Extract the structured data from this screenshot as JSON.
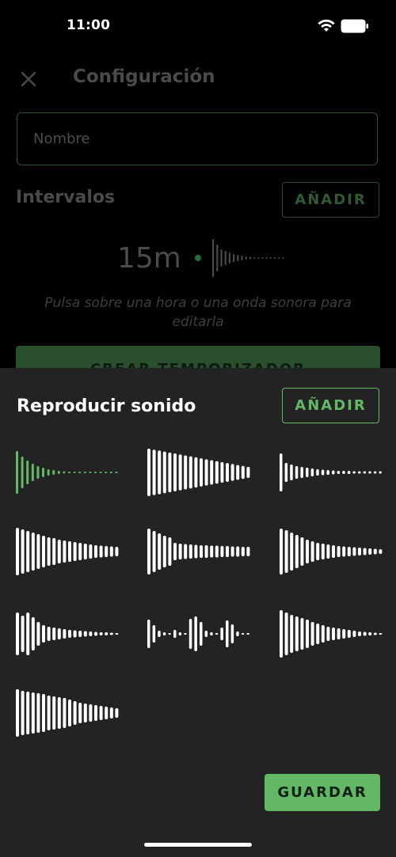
{
  "status_bar": {
    "time": "11:00",
    "icons": [
      "wifi-icon",
      "battery-icon"
    ]
  },
  "header": {
    "title": "Configuración",
    "close_icon": "close-icon"
  },
  "name_field": {
    "placeholder": "Nombre",
    "value": ""
  },
  "intervals": {
    "title": "Intervalos",
    "add_label": "AÑADIR",
    "items": [
      {
        "time": "15m"
      }
    ],
    "hint": "Pulsa sobre una hora o una onda sonora para editarla"
  },
  "create_timer_label": "CREAR TEMPORIZADOR",
  "sound_sheet": {
    "title": "Reproducir sonido",
    "add_label": "AÑADIR",
    "sounds": [
      {
        "name": "sound-1",
        "selected": true
      },
      {
        "name": "sound-2",
        "selected": false
      },
      {
        "name": "sound-3",
        "selected": false
      },
      {
        "name": "sound-4",
        "selected": false
      },
      {
        "name": "sound-5",
        "selected": false
      },
      {
        "name": "sound-6",
        "selected": false
      },
      {
        "name": "sound-7",
        "selected": false
      },
      {
        "name": "sound-8",
        "selected": false
      },
      {
        "name": "sound-9",
        "selected": false
      },
      {
        "name": "sound-10",
        "selected": false
      }
    ],
    "save_label": "GUARDAR"
  },
  "colors": {
    "accent": "#63b866",
    "background": "#000000",
    "sheet": "#232323",
    "wave_default": "#ffffff"
  }
}
